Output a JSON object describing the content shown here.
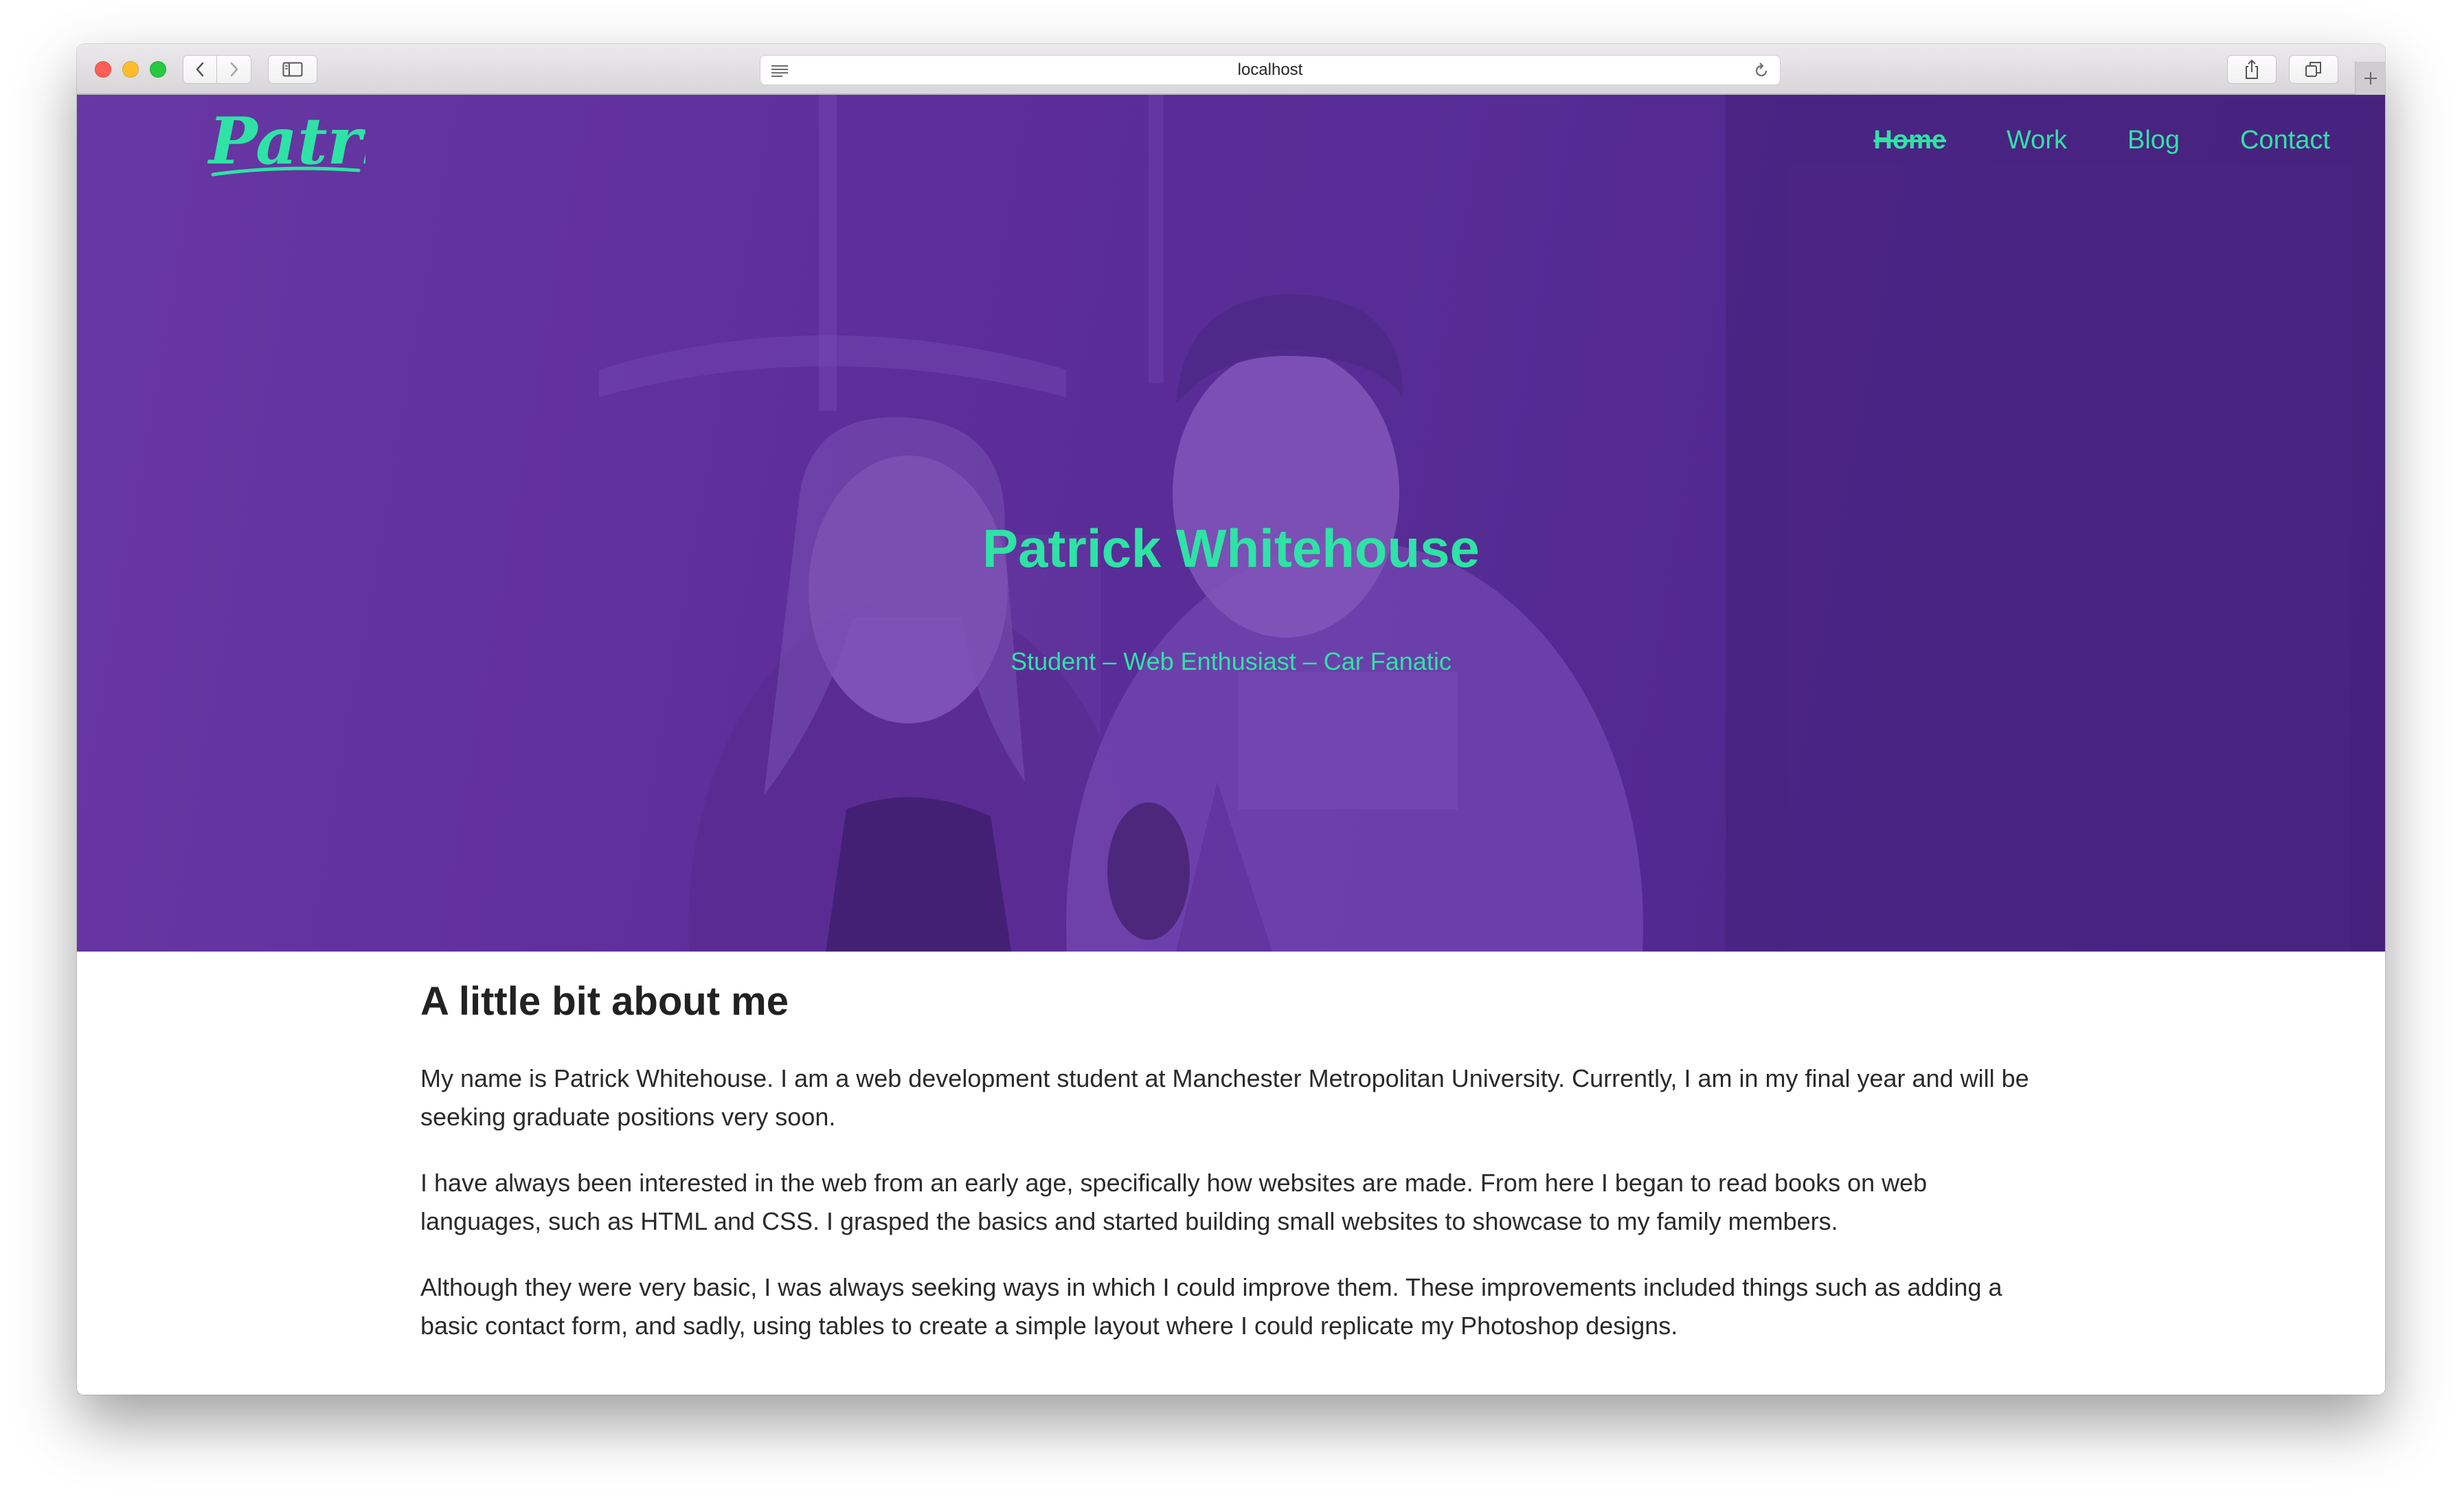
{
  "browser": {
    "url": "localhost"
  },
  "site": {
    "logo_text": "Patrick",
    "nav": [
      {
        "label": "Home",
        "active": true
      },
      {
        "label": "Work",
        "active": false
      },
      {
        "label": "Blog",
        "active": false
      },
      {
        "label": "Contact",
        "active": false
      }
    ]
  },
  "hero": {
    "title": "Patrick Whitehouse",
    "subtitle": "Student – Web Enthusiast – Car Fanatic"
  },
  "about": {
    "heading": "A little bit about me",
    "paragraphs": [
      "My name is Patrick Whitehouse. I am a web development student at Manchester Metropolitan University. Currently, I am in my final year and will be seeking graduate positions very soon.",
      "I have always been interested in the web from an early age, specifically how websites are made. From here I began to read books on web languages, such as HTML and CSS. I grasped the basics and started building small websites to showcase to my family members.",
      "Although they were very basic, I was always seeking ways in which I could improve them. These improvements included things such as adding a basic contact form, and sadly, using tables to create a simple layout where I could replicate my Photoshop designs."
    ]
  },
  "colors": {
    "accent": "#2ee3a5",
    "hero_overlay": "#5a2d96",
    "text": "#2a2a2a"
  },
  "icons": {
    "back": "chevron-left-icon",
    "forward": "chevron-right-icon",
    "sidebar": "sidebar-icon",
    "reader": "reader-icon",
    "reload": "reload-icon",
    "share": "share-icon",
    "tabs": "tabs-icon",
    "new_tab": "plus-icon"
  }
}
